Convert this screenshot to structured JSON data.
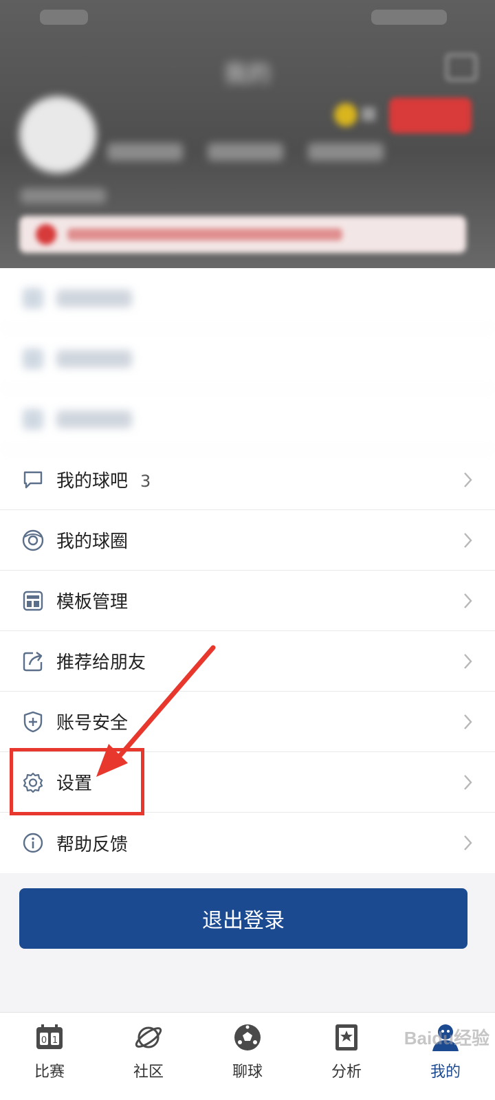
{
  "header": {
    "title": "我的",
    "nickname": "",
    "sign_label": ""
  },
  "menu": {
    "items": [
      {
        "label": "我的球吧",
        "count": "3",
        "icon": "chat-bubble-icon"
      },
      {
        "label": "我的球圈",
        "count": "",
        "icon": "circle-ball-icon"
      },
      {
        "label": "模板管理",
        "count": "",
        "icon": "template-icon"
      },
      {
        "label": "推荐给朋友",
        "count": "",
        "icon": "share-icon"
      },
      {
        "label": "账号安全",
        "count": "",
        "icon": "shield-icon"
      },
      {
        "label": "设置",
        "count": "",
        "icon": "gear-icon"
      },
      {
        "label": "帮助反馈",
        "count": "",
        "icon": "info-icon"
      }
    ]
  },
  "logout": {
    "label": "退出登录"
  },
  "tabbar": {
    "tabs": [
      {
        "label": "比赛",
        "icon": "scoreboard-icon",
        "active": false
      },
      {
        "label": "社区",
        "icon": "planet-icon",
        "active": false
      },
      {
        "label": "聊球",
        "icon": "soccer-ball-icon",
        "active": false
      },
      {
        "label": "分析",
        "icon": "star-book-icon",
        "active": false
      },
      {
        "label": "我的",
        "icon": "user-icon",
        "active": true
      }
    ]
  },
  "watermark": "Baidu经验",
  "colors": {
    "primary": "#1c4a91",
    "annotation": "#e8382d",
    "sign_button": "#d93a3a"
  }
}
